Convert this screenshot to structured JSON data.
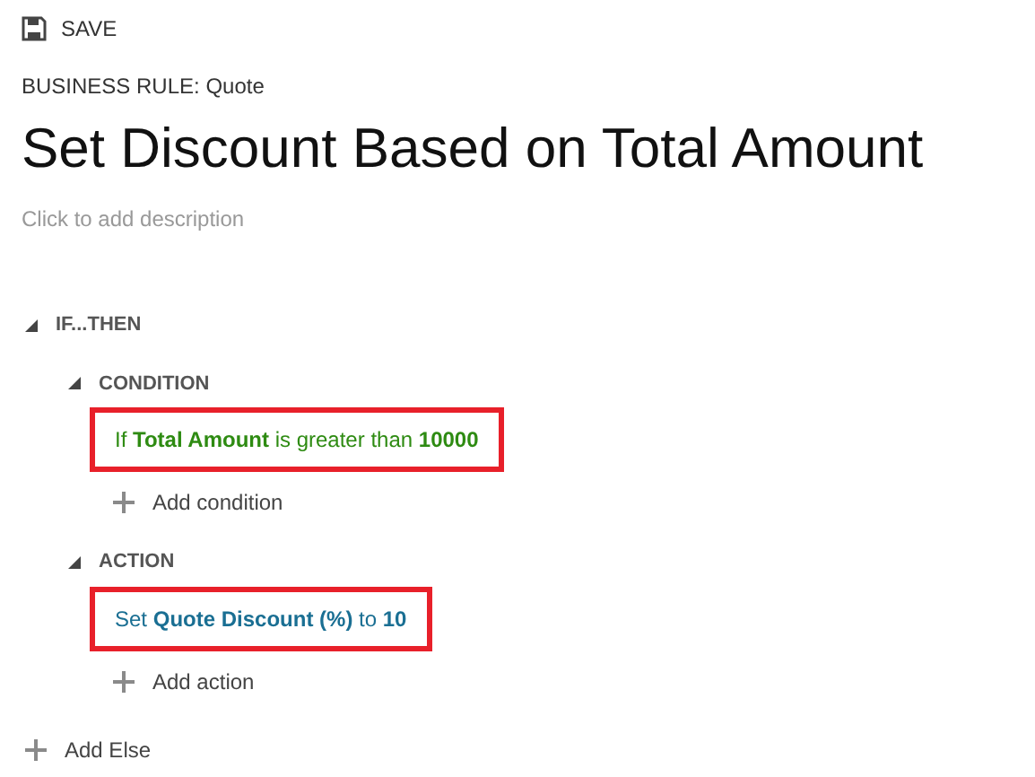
{
  "toolbar": {
    "save_label": "SAVE"
  },
  "entity_label": "BUSINESS RULE: Quote",
  "title": "Set Discount Based on Total Amount",
  "description": {
    "placeholder": "Click to add description"
  },
  "if_then": {
    "label": "IF...THEN",
    "expanded": true,
    "sections": [
      {
        "label": "CONDITION",
        "expanded": true,
        "statements": [
          {
            "text": "If **Total Amount** is greater than **10000**",
            "color": "#2e8b12",
            "highlighted": true
          }
        ],
        "add_label": "Add condition"
      },
      {
        "label": "ACTION",
        "expanded": true,
        "statements": [
          {
            "text": "Set **Quote Discount (%)** to **10**",
            "color": "#1a6f93",
            "highlighted": true
          }
        ],
        "add_label": "Add action"
      }
    ]
  },
  "add_else": "Add Else"
}
